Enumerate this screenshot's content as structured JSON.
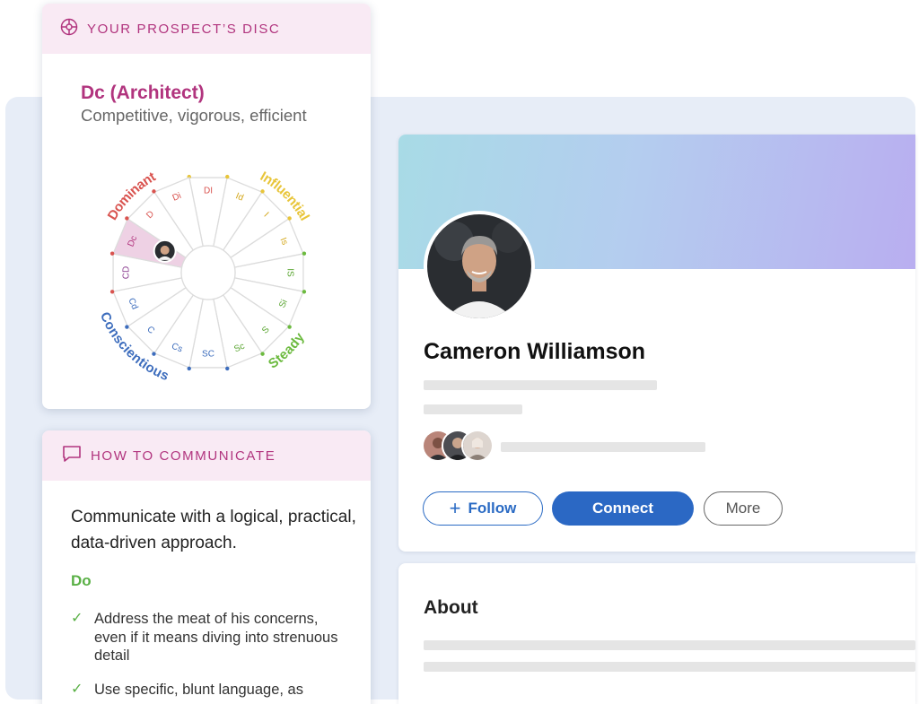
{
  "disc_card": {
    "header_label": "YOUR PROSPECT’S DISC",
    "type_label": "Dc (Architect)",
    "traits": "Competitive, vigorous, efficient",
    "quadrants": [
      "Dominant",
      "Influential",
      "Steady",
      "Conscientious"
    ],
    "segments": [
      "DI",
      "Id",
      "I",
      "Is",
      "IS",
      "Si",
      "S",
      "Sc",
      "SC",
      "Cs",
      "C",
      "Cd",
      "CD",
      "Dc",
      "D",
      "Di"
    ],
    "highlighted_segment": "Dc",
    "colors": {
      "dominant": "#d9534f",
      "influential": "#e8c53a",
      "steady": "#6cba3f",
      "conscientious": "#3d6dbd",
      "highlight": "#eed1e4"
    }
  },
  "communicate_card": {
    "header_label": "HOW TO COMMUNICATE",
    "intro": "Communicate with a logical, practical, data-driven approach.",
    "do_label": "Do",
    "do_items": [
      "Address the meat of his concerns, even if it means diving into strenuous detail",
      "Use specific, blunt language, as"
    ]
  },
  "profile": {
    "name": "Cameron Williamson",
    "follow_label": "Follow",
    "connect_label": "Connect",
    "more_label": "More",
    "about_title": "About"
  }
}
